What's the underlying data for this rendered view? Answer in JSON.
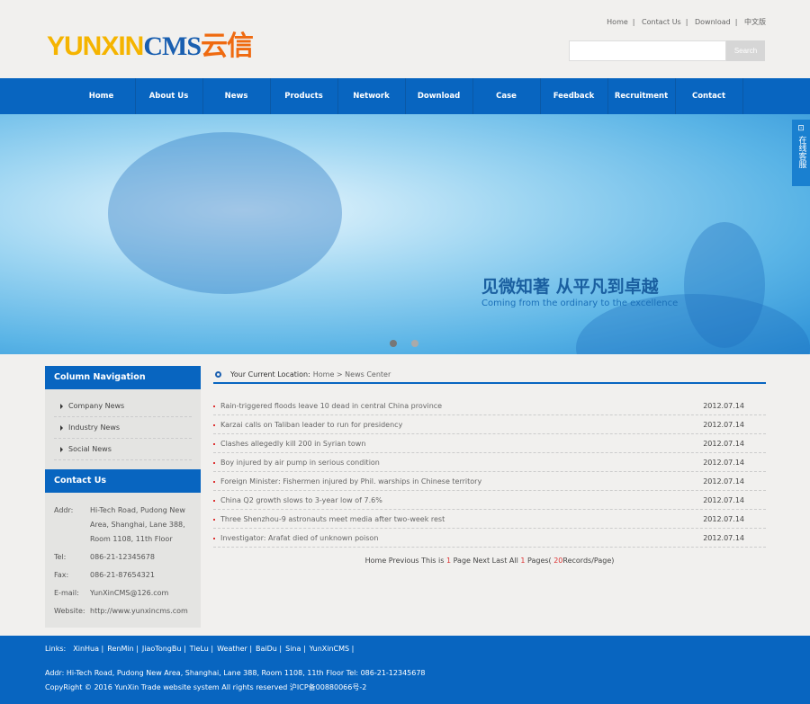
{
  "header": {
    "logo": {
      "part1": "YUNXIN",
      "part2": "CMS",
      "part3": "云信"
    },
    "top_links": [
      "Home",
      "Contact Us",
      "Download",
      "中文版"
    ],
    "search": {
      "placeholder": "",
      "button": "Search"
    }
  },
  "nav": [
    "Home",
    "About Us",
    "News",
    "Products",
    "Network",
    "Download",
    "Case",
    "Feedback",
    "Recruitment",
    "Contact"
  ],
  "banner": {
    "title": "见微知著 从平凡到卓越",
    "subtitle": "Coming from the ordinary to the excellence",
    "slide_count": 2,
    "active_slide": 1
  },
  "service_tab": {
    "label": "在线客服"
  },
  "sidebar": {
    "nav_title": "Column Navigation",
    "items": [
      "Company News",
      "Industry News",
      "Social News"
    ],
    "contact_title": "Contact Us",
    "contact": [
      {
        "k": "Addr:",
        "v": "Hi-Tech Road, Pudong New Area, Shanghai, Lane 388, Room 1108, 11th Floor"
      },
      {
        "k": "Tel:",
        "v": "086-21-12345678"
      },
      {
        "k": "Fax:",
        "v": "086-21-87654321"
      },
      {
        "k": "E-mail:",
        "v": "YunXinCMS@126.com"
      },
      {
        "k": "Website:",
        "v": "http://www.yunxincms.com"
      }
    ]
  },
  "location": {
    "label": "Your Current Location:",
    "path": "Home > News Center"
  },
  "news": [
    {
      "title": "Rain-triggered floods leave 10 dead in central China province",
      "date": "2012.07.14"
    },
    {
      "title": "Karzai calls on Taliban leader to run for presidency",
      "date": "2012.07.14"
    },
    {
      "title": "Clashes allegedly kill 200 in Syrian town",
      "date": "2012.07.14"
    },
    {
      "title": "Boy injured by air pump in serious condition",
      "date": "2012.07.14"
    },
    {
      "title": "Foreign Minister: Fishermen injured by Phil. warships in Chinese territory",
      "date": "2012.07.14"
    },
    {
      "title": "China Q2 growth slows to 3-year low of 7.6%",
      "date": "2012.07.14"
    },
    {
      "title": "Three Shenzhou-9 astronauts meet media after two-week rest",
      "date": "2012.07.14"
    },
    {
      "title": "Investigator: Arafat died of unknown poison",
      "date": "2012.07.14"
    }
  ],
  "pager": {
    "a": "Home Previous This is ",
    "page": "1",
    "b": " Page Next Last All ",
    "pages": "1",
    "c": " Pages( ",
    "per": "20",
    "d": "Records/Page)"
  },
  "footer": {
    "links_label": "Links:",
    "links": [
      "XinHua",
      "RenMin",
      "JiaoTongBu",
      "TieLu",
      "Weather",
      "BaiDu",
      "Sina",
      "YunXinCMS"
    ],
    "addr": "Addr: Hi-Tech Road, Pudong New Area, Shanghai, Lane 388, Room 1108, 11th Floor  Tel: 086-21-12345678",
    "copyright": "CopyRight © 2016 YunXin Trade website system  All rights reserved  沪ICP备00880066号-2"
  }
}
